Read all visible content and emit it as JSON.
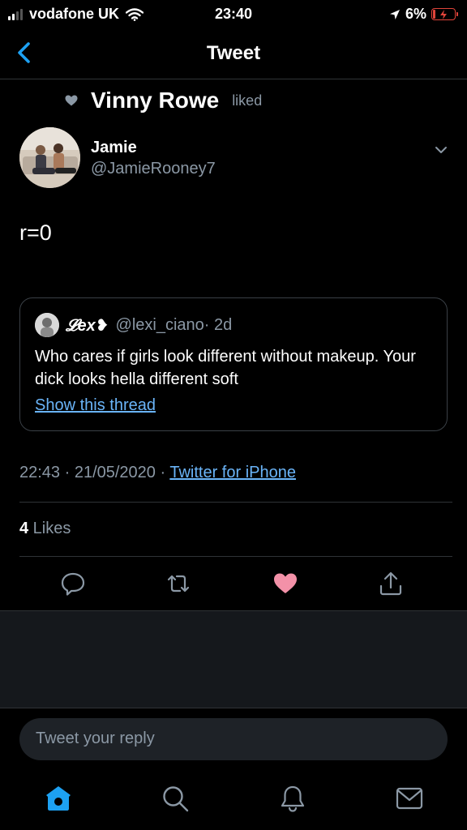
{
  "status_bar": {
    "carrier": "vodafone UK",
    "time": "23:40",
    "battery": "6%",
    "battery_color": "#e0443a"
  },
  "nav": {
    "title": "Tweet",
    "back_icon": "back-chevron-icon"
  },
  "social_context": {
    "liker": "Vinny Rowe",
    "action": "liked",
    "icon": "heart-icon"
  },
  "tweet": {
    "author_name": "Jamie",
    "author_handle": "@JamieRooney7",
    "text": "r=0",
    "timestamp": "22:43 · 21/05/2020 · ",
    "source": "Twitter for iPhone",
    "likes_count": "4",
    "likes_label": " Likes"
  },
  "quoted_tweet": {
    "name": "𝓛ex❥",
    "handle": "@lexi_ciano",
    "age": " · 2d",
    "text": "Who cares if girls look different without makeup. Your dick looks hella different soft",
    "link": "Show this thread"
  },
  "actions": [
    {
      "name": "reply",
      "icon": "comment-icon"
    },
    {
      "name": "retweet",
      "icon": "retweet-icon"
    },
    {
      "name": "like",
      "icon": "heart-filled-icon",
      "active": true
    },
    {
      "name": "share",
      "icon": "share-icon"
    }
  ],
  "reply": {
    "placeholder": "Tweet your reply"
  },
  "tabs": [
    {
      "name": "home",
      "icon": "home-icon",
      "active": true
    },
    {
      "name": "search",
      "icon": "search-icon"
    },
    {
      "name": "notifications",
      "icon": "bell-icon"
    },
    {
      "name": "messages",
      "icon": "mail-icon"
    }
  ],
  "colors": {
    "accent": "#1da1f2",
    "link": "#6ab4f8",
    "like": "#f391a8",
    "muted": "#8b98a5"
  }
}
